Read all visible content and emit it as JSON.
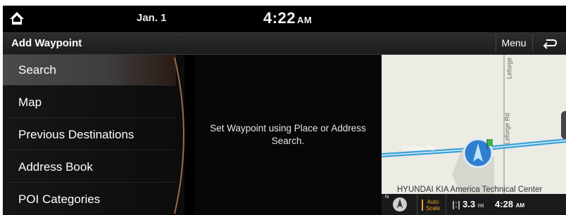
{
  "status": {
    "date": "Jan. 1",
    "time": "4:22",
    "ampm": "AM"
  },
  "header": {
    "title": "Add Waypoint",
    "menu_label": "Menu"
  },
  "sidebar": {
    "items": [
      {
        "label": "Search",
        "active": true
      },
      {
        "label": "Map"
      },
      {
        "label": "Previous Destinations"
      },
      {
        "label": "Address Book"
      },
      {
        "label": "POI Categories"
      }
    ]
  },
  "main": {
    "message": "Set Waypoint using Place or Address Search."
  },
  "map": {
    "road_horizontal": "Geddes Rd",
    "road_vertical_top": "Leforge",
    "road_vertical_mid": "Leforge Rd",
    "poi_label": "HYUNDAI KIA America Technical Center",
    "compass_label": "N",
    "auto_scale_line1": "Auto",
    "auto_scale_line2": "Scale",
    "distance_value": "3.3",
    "distance_unit": "mi",
    "eta_time": "4:28",
    "eta_ampm": "AM"
  },
  "colors": {
    "accent_orange": "#f5a623",
    "road_blue": "#3aa0d8",
    "vehicle_blue": "#2f7fd0"
  }
}
